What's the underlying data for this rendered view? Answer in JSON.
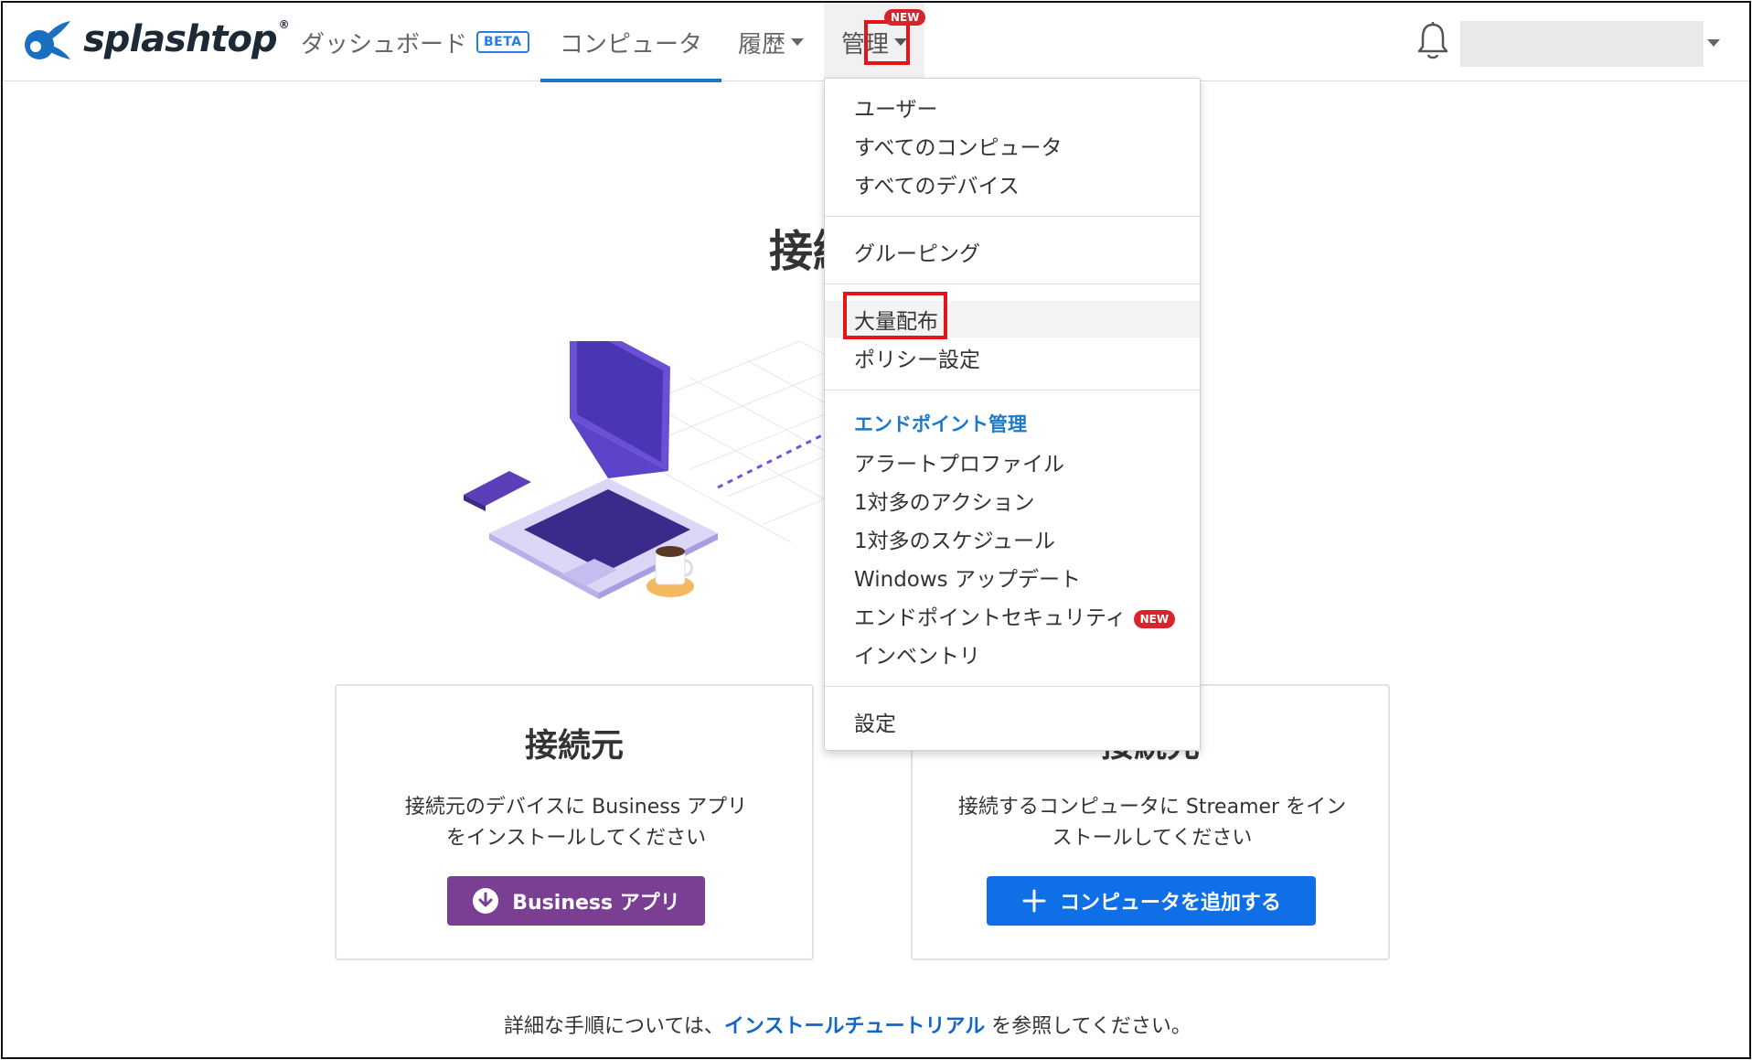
{
  "header": {
    "logo_text": "splashtop",
    "logo_tm": "®",
    "nav": {
      "dashboard": "ダッシュボード",
      "beta": "BETA",
      "computer": "コンピュータ",
      "history": "履歴",
      "manage": "管理",
      "manage_badge": "NEW"
    },
    "icons": {
      "bell": "bell-icon",
      "user_menu": "chevron-down-icon"
    }
  },
  "menu": {
    "items_group1": [
      "ユーザー",
      "すべてのコンピュータ",
      "すべてのデバイス"
    ],
    "items_group2": [
      "グルーピング"
    ],
    "items_group3": [
      "大量配布",
      "ポリシー設定"
    ],
    "section_title": "エンドポイント管理",
    "items_group4": [
      "アラートプロファイル",
      "1対多のアクション",
      "1対多のスケジュール",
      "Windows アップデート",
      "エンドポイントセキュリティ",
      "インベントリ"
    ],
    "security_badge": "NEW",
    "items_group5": [
      "設定"
    ]
  },
  "main": {
    "headline": "接続",
    "card_left": {
      "title": "接続元",
      "desc_line1": "接続元のデバイスに Business アプリ",
      "desc_line2": "をインストールしてください",
      "button": "Business アプリ"
    },
    "card_right": {
      "title": "接続先",
      "desc_line1": "接続するコンピュータに Streamer をイン",
      "desc_line2": "ストールしてください",
      "button": "コンピュータを追加する"
    },
    "footer_prefix": "詳細な手順については、",
    "footer_link": "インストールチュートリアル",
    "footer_suffix": " を参照してください。"
  },
  "colors": {
    "accent_blue": "#1d74c9",
    "business_purple": "#7a3e93",
    "add_button_blue": "#0f6fe6",
    "highlight_red": "#e3151a",
    "badge_red": "#d9232b"
  }
}
